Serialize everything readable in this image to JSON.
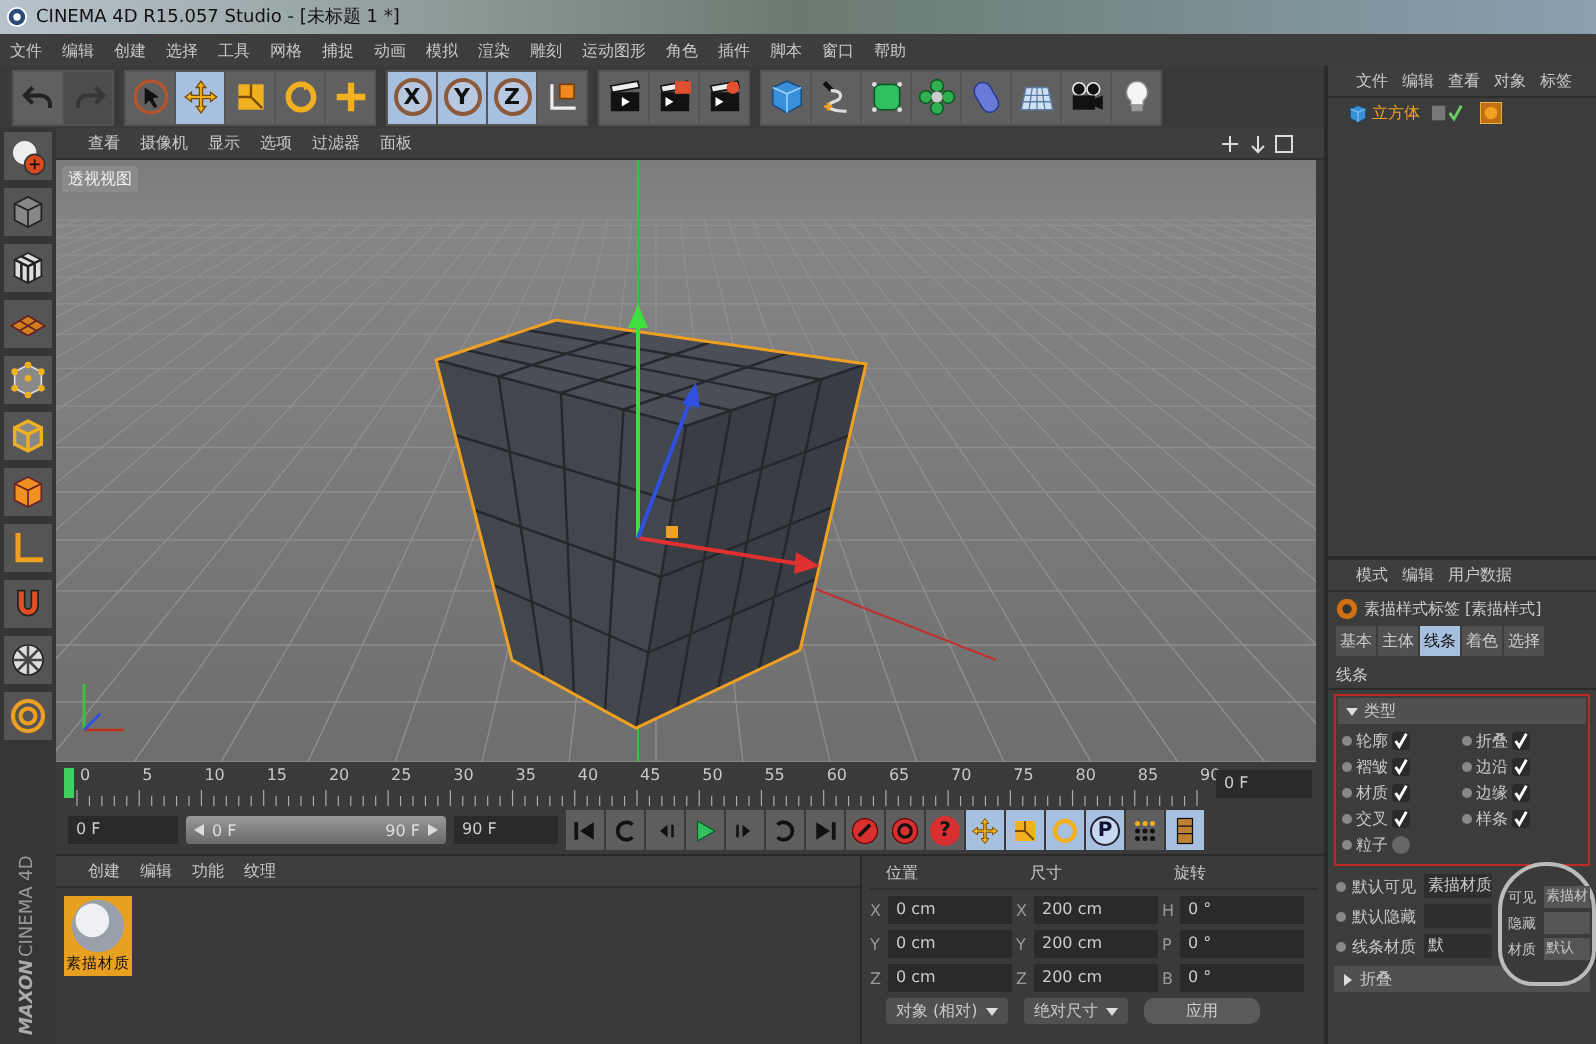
{
  "window": {
    "title": "CINEMA 4D R15.057 Studio - [未标题 1 *]"
  },
  "menu": [
    "文件",
    "编辑",
    "创建",
    "选择",
    "工具",
    "网格",
    "捕捉",
    "动画",
    "模拟",
    "渲染",
    "雕刻",
    "运动图形",
    "角色",
    "插件",
    "脚本",
    "窗口",
    "帮助"
  ],
  "toolbar": [
    [
      {
        "kind": "undo",
        "selected": false,
        "disabled": false
      },
      {
        "kind": "redo",
        "selected": false,
        "disabled": true
      }
    ],
    [
      {
        "kind": "live-select",
        "selected": false
      },
      {
        "kind": "move",
        "selected": true
      },
      {
        "kind": "scale",
        "selected": false
      },
      {
        "kind": "rotate",
        "selected": false
      },
      {
        "kind": "add",
        "selected": false
      }
    ],
    [
      {
        "kind": "axis",
        "glyph": "X",
        "selected": true
      },
      {
        "kind": "axis",
        "glyph": "Y",
        "selected": true
      },
      {
        "kind": "axis",
        "glyph": "Z",
        "selected": true
      },
      {
        "kind": "coords",
        "selected": false
      }
    ],
    [
      {
        "kind": "render-view",
        "selected": false
      },
      {
        "kind": "render-picture",
        "selected": false
      },
      {
        "kind": "render-settings",
        "selected": false
      }
    ],
    [
      {
        "kind": "cube",
        "selected": false
      },
      {
        "kind": "pen",
        "selected": false
      },
      {
        "kind": "subdivision",
        "selected": false
      },
      {
        "kind": "cloner",
        "selected": false
      },
      {
        "kind": "deformer",
        "selected": false
      },
      {
        "kind": "floor",
        "selected": false
      },
      {
        "kind": "camera",
        "selected": false
      },
      {
        "kind": "light",
        "selected": false
      }
    ]
  ],
  "viewport": {
    "menu": [
      "查看",
      "摄像机",
      "显示",
      "选项",
      "过滤器",
      "面板"
    ],
    "label": "透视视图"
  },
  "timeline": {
    "ticks": [
      "0",
      "5",
      "10",
      "15",
      "20",
      "25",
      "30",
      "35",
      "40",
      "45",
      "50",
      "55",
      "60",
      "65",
      "70",
      "75",
      "80",
      "85",
      "90"
    ],
    "level": 0,
    "frame_field": "0 F"
  },
  "range": {
    "level": 1,
    "start_field": "0 F",
    "slider_start": "0 F",
    "slider_end": "90 F",
    "end_field": "90 F"
  },
  "transport": [
    {
      "kind": "go-start",
      "selected": false
    },
    {
      "kind": "prev-key",
      "selected": false
    },
    {
      "kind": "prev-frame",
      "selected": false
    },
    {
      "kind": "play",
      "selected": false
    },
    {
      "kind": "next-frame",
      "selected": false
    },
    {
      "kind": "next-key",
      "selected": false
    },
    {
      "kind": "go-end",
      "selected": false
    },
    {
      "kind": "record",
      "selected": false
    },
    {
      "kind": "autokey",
      "selected": false
    },
    {
      "kind": "key-select",
      "glyph": "?",
      "selected": false
    },
    {
      "kind": "pos-key",
      "selected": true
    },
    {
      "kind": "scale-key",
      "selected": true
    },
    {
      "kind": "rot-key",
      "selected": true
    },
    {
      "kind": "param-key",
      "glyph": "P",
      "selected": true
    },
    {
      "kind": "pla-key",
      "selected": false
    },
    {
      "kind": "timeline",
      "selected": true
    }
  ],
  "materials": {
    "menu": [
      "创建",
      "编辑",
      "功能",
      "纹理"
    ],
    "items": [
      {
        "name": "素描材质",
        "selected": true
      }
    ]
  },
  "coordinates": {
    "headers": [
      "位置",
      "尺寸",
      "旋转"
    ],
    "rows": [
      {
        "axis": "X",
        "position": "0 cm",
        "size_axis": "X",
        "size": "200 cm",
        "rot_axis": "H",
        "rotation": "0 °"
      },
      {
        "axis": "Y",
        "position": "0 cm",
        "size_axis": "Y",
        "size": "200 cm",
        "rot_axis": "P",
        "rotation": "0 °"
      },
      {
        "axis": "Z",
        "position": "0 cm",
        "size_axis": "Z",
        "size": "200 cm",
        "rot_axis": "B",
        "rotation": "0 °"
      }
    ],
    "mode": "对象 (相对)",
    "size_mode": "绝对尺寸",
    "apply": "应用"
  },
  "logo": {
    "brand": "MAXON",
    "product": "CINEMA 4D"
  },
  "object_manager": {
    "menu": [
      "文件",
      "编辑",
      "查看",
      "对象",
      "标签"
    ],
    "objects": [
      {
        "name": "立方体",
        "selected": true
      }
    ]
  },
  "attributes": {
    "menu": [
      "模式",
      "编辑",
      "用户数据"
    ],
    "title": "素描样式标签 [素描样式]",
    "tabs": [
      {
        "label": "基本",
        "selected": false
      },
      {
        "label": "主体",
        "selected": false
      },
      {
        "label": "线条",
        "selected": true
      },
      {
        "label": "着色",
        "selected": false
      },
      {
        "label": "选择",
        "selected": false
      }
    ],
    "section": "线条",
    "group": {
      "title": "类型",
      "expanded": true,
      "highlighted": true,
      "options": [
        {
          "label": "轮廓",
          "checked": true
        },
        {
          "label": "折叠",
          "checked": true
        },
        {
          "label": "褶皱",
          "checked": true
        },
        {
          "label": "边沿",
          "checked": true
        },
        {
          "label": "材质",
          "checked": true
        },
        {
          "label": "边缘",
          "checked": true
        },
        {
          "label": "交叉",
          "checked": true
        },
        {
          "label": "样条",
          "checked": true
        },
        {
          "label": "粒子",
          "checked": false
        }
      ]
    },
    "fields": [
      {
        "label": "默认可见",
        "value": "素描材质"
      },
      {
        "label": "默认隐藏"
      },
      {
        "label": "线条材质",
        "value": "默"
      }
    ],
    "lens": [
      {
        "label": "可见",
        "value": "素描材"
      },
      {
        "label": "隐藏"
      },
      {
        "label": "材质",
        "value": "默认"
      }
    ],
    "collapsed_group": {
      "title": "折叠",
      "expanded": false
    }
  }
}
